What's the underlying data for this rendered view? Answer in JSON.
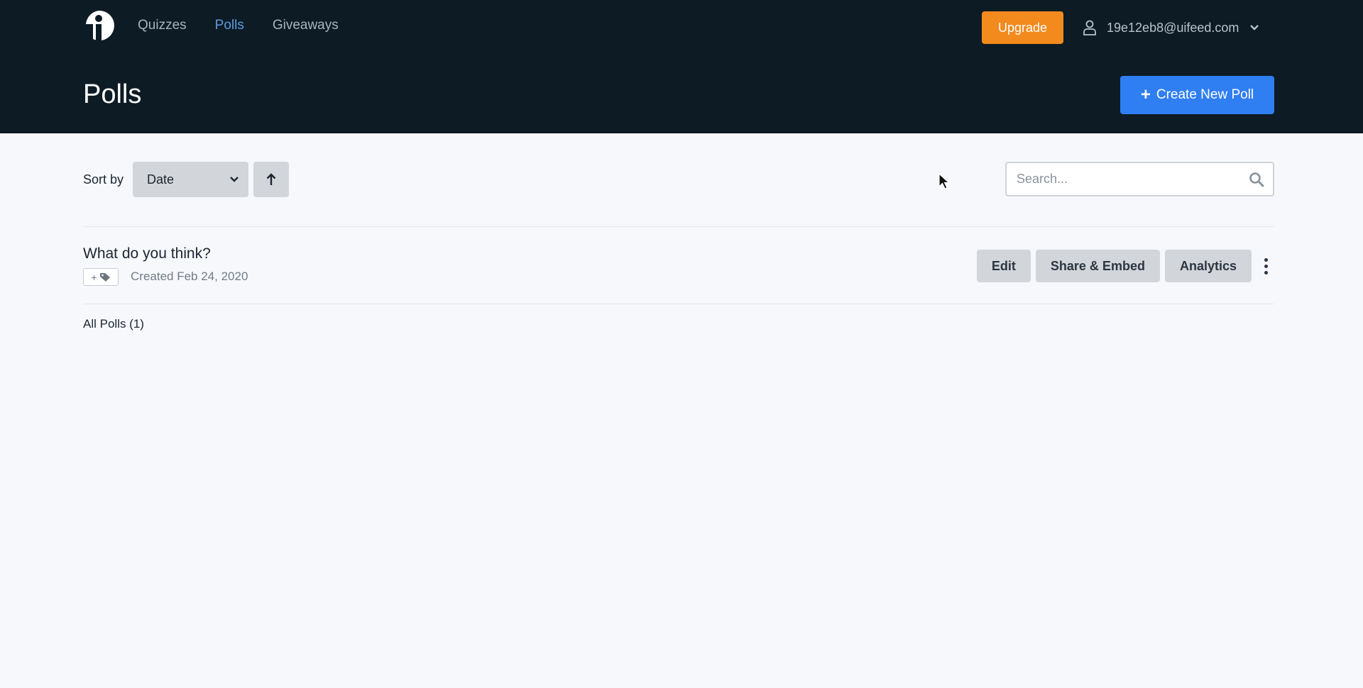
{
  "nav": {
    "logo_icon": "info-i-logo",
    "links": [
      {
        "label": "Quizzes",
        "active": false
      },
      {
        "label": "Polls",
        "active": true
      },
      {
        "label": "Giveaways",
        "active": false
      }
    ],
    "upgrade_label": "Upgrade",
    "user_email": "19e12eb8@uifeed.com",
    "user_icon": "user-icon"
  },
  "header": {
    "title": "Polls",
    "create_label": "Create New Poll"
  },
  "toolbar": {
    "sort_label": "Sort by",
    "sort_value": "Date",
    "sort_direction": "ascending",
    "search_placeholder": "Search..."
  },
  "polls": [
    {
      "title": "What do you think?",
      "tag_label": "+",
      "created": "Created Feb 24, 2020",
      "actions": [
        "Edit",
        "Share & Embed",
        "Analytics"
      ]
    }
  ],
  "footer": {
    "all_polls_label": "All Polls (1)"
  },
  "colors": {
    "header_bg": "#0d1b24",
    "active_nav": "#5b9be0",
    "upgrade": "#f28a1e",
    "primary": "#2f7ef2",
    "page_bg": "#f6f8fc"
  }
}
